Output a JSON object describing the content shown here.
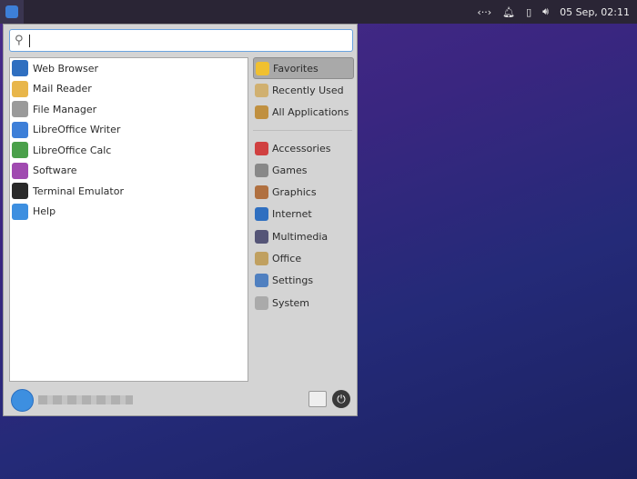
{
  "panel": {
    "clock": "05 Sep, 02:11",
    "tray_icons": [
      "network-icon",
      "bell-icon",
      "battery-icon",
      "volume-icon"
    ]
  },
  "search": {
    "value": "",
    "placeholder": ""
  },
  "apps": [
    {
      "label": "Web Browser",
      "color": "#2f6fc0"
    },
    {
      "label": "Mail Reader",
      "color": "#e8b64a"
    },
    {
      "label": "File Manager",
      "color": "#9a9a9a"
    },
    {
      "label": "LibreOffice Writer",
      "color": "#3d7fd8"
    },
    {
      "label": "LibreOffice Calc",
      "color": "#4aa04a"
    },
    {
      "label": "Software",
      "color": "#a04ab0"
    },
    {
      "label": "Terminal Emulator",
      "color": "#2a2a2a"
    },
    {
      "label": "Help",
      "color": "#3d8fe0"
    }
  ],
  "categories": [
    {
      "label": "Favorites",
      "color": "#f0c030",
      "selected": true
    },
    {
      "label": "Recently Used",
      "color": "#d0b070"
    },
    {
      "label": "All Applications",
      "color": "#c09040"
    },
    {
      "label": "Accessories",
      "color": "#d04040"
    },
    {
      "label": "Games",
      "color": "#888888"
    },
    {
      "label": "Graphics",
      "color": "#b07040"
    },
    {
      "label": "Internet",
      "color": "#2f6fc0"
    },
    {
      "label": "Multimedia",
      "color": "#555577"
    },
    {
      "label": "Office",
      "color": "#c0a060"
    },
    {
      "label": "Settings",
      "color": "#5080c0"
    },
    {
      "label": "System",
      "color": "#aaaaaa"
    }
  ]
}
